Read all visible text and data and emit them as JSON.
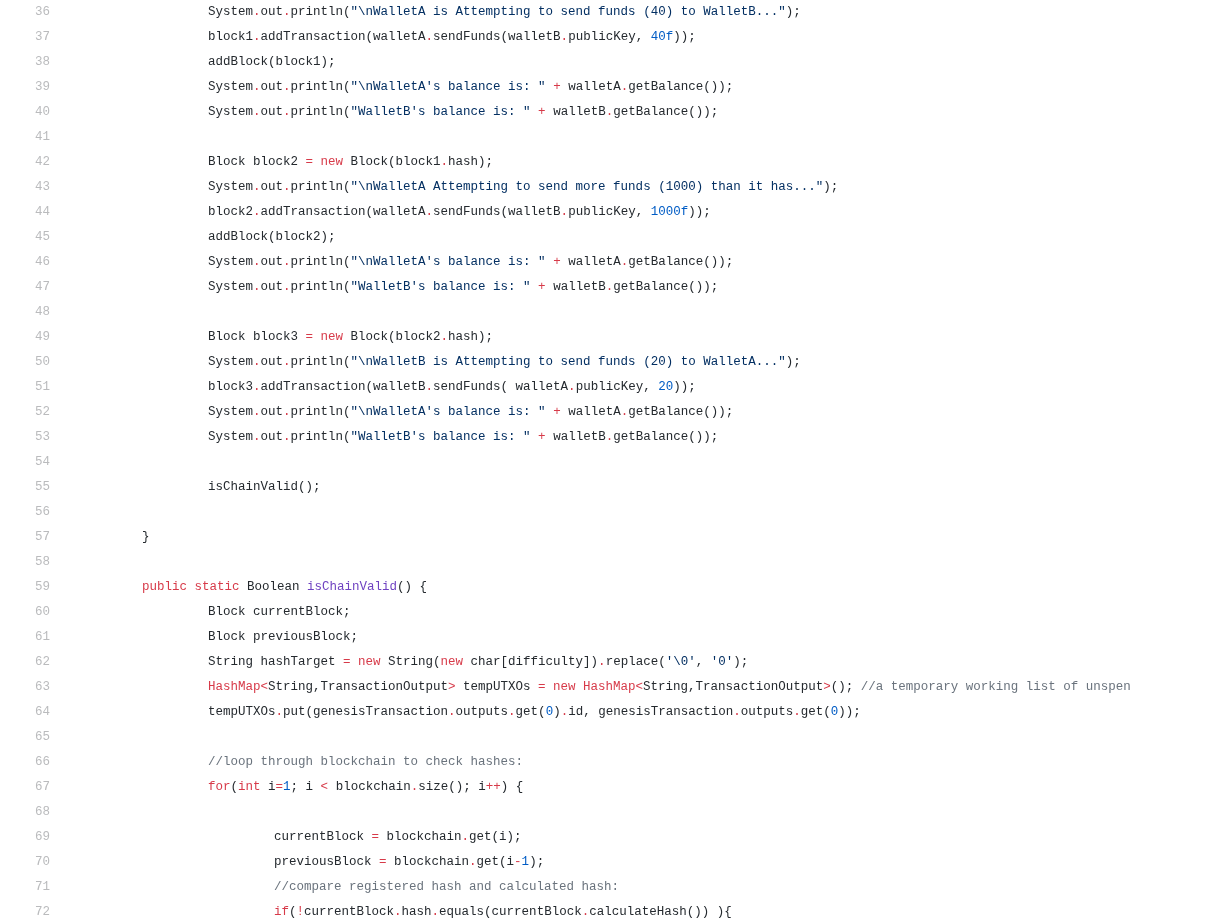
{
  "code_lines": [
    {
      "number": "36",
      "tokens": [
        {
          "kind": "p",
          "text": "\t\tSystem"
        },
        {
          "kind": "o",
          "text": "."
        },
        {
          "kind": "p",
          "text": "out"
        },
        {
          "kind": "o",
          "text": "."
        },
        {
          "kind": "p",
          "text": "println("
        },
        {
          "kind": "s",
          "text": "\"\\nWalletA is Attempting to send funds (40) to WalletB...\""
        },
        {
          "kind": "p",
          "text": ");"
        }
      ]
    },
    {
      "number": "37",
      "tokens": [
        {
          "kind": "p",
          "text": "\t\tblock1"
        },
        {
          "kind": "o",
          "text": "."
        },
        {
          "kind": "p",
          "text": "addTransaction(walletA"
        },
        {
          "kind": "o",
          "text": "."
        },
        {
          "kind": "p",
          "text": "sendFunds(walletB"
        },
        {
          "kind": "o",
          "text": "."
        },
        {
          "kind": "p",
          "text": "publicKey, "
        },
        {
          "kind": "n",
          "text": "40f"
        },
        {
          "kind": "p",
          "text": "));"
        }
      ]
    },
    {
      "number": "38",
      "tokens": [
        {
          "kind": "p",
          "text": "\t\taddBlock(block1);"
        }
      ]
    },
    {
      "number": "39",
      "tokens": [
        {
          "kind": "p",
          "text": "\t\tSystem"
        },
        {
          "kind": "o",
          "text": "."
        },
        {
          "kind": "p",
          "text": "out"
        },
        {
          "kind": "o",
          "text": "."
        },
        {
          "kind": "p",
          "text": "println("
        },
        {
          "kind": "s",
          "text": "\"\\nWalletA's balance is: \""
        },
        {
          "kind": "o",
          "text": " + "
        },
        {
          "kind": "p",
          "text": "walletA"
        },
        {
          "kind": "o",
          "text": "."
        },
        {
          "kind": "p",
          "text": "getBalance());"
        }
      ]
    },
    {
      "number": "40",
      "tokens": [
        {
          "kind": "p",
          "text": "\t\tSystem"
        },
        {
          "kind": "o",
          "text": "."
        },
        {
          "kind": "p",
          "text": "out"
        },
        {
          "kind": "o",
          "text": "."
        },
        {
          "kind": "p",
          "text": "println("
        },
        {
          "kind": "s",
          "text": "\"WalletB's balance is: \""
        },
        {
          "kind": "o",
          "text": " + "
        },
        {
          "kind": "p",
          "text": "walletB"
        },
        {
          "kind": "o",
          "text": "."
        },
        {
          "kind": "p",
          "text": "getBalance());"
        }
      ]
    },
    {
      "number": "41"
    },
    {
      "number": "42",
      "tokens": [
        {
          "kind": "p",
          "text": "\t\tBlock block2 "
        },
        {
          "kind": "o",
          "text": "= new"
        },
        {
          "kind": "p",
          "text": " Block(block1"
        },
        {
          "kind": "o",
          "text": "."
        },
        {
          "kind": "p",
          "text": "hash);"
        }
      ]
    },
    {
      "number": "43",
      "tokens": [
        {
          "kind": "p",
          "text": "\t\tSystem"
        },
        {
          "kind": "o",
          "text": "."
        },
        {
          "kind": "p",
          "text": "out"
        },
        {
          "kind": "o",
          "text": "."
        },
        {
          "kind": "p",
          "text": "println("
        },
        {
          "kind": "s",
          "text": "\"\\nWalletA Attempting to send more funds (1000) than it has...\""
        },
        {
          "kind": "p",
          "text": ");"
        }
      ]
    },
    {
      "number": "44",
      "tokens": [
        {
          "kind": "p",
          "text": "\t\tblock2"
        },
        {
          "kind": "o",
          "text": "."
        },
        {
          "kind": "p",
          "text": "addTransaction(walletA"
        },
        {
          "kind": "o",
          "text": "."
        },
        {
          "kind": "p",
          "text": "sendFunds(walletB"
        },
        {
          "kind": "o",
          "text": "."
        },
        {
          "kind": "p",
          "text": "publicKey, "
        },
        {
          "kind": "n",
          "text": "1000f"
        },
        {
          "kind": "p",
          "text": "));"
        }
      ]
    },
    {
      "number": "45",
      "tokens": [
        {
          "kind": "p",
          "text": "\t\taddBlock(block2);"
        }
      ]
    },
    {
      "number": "46",
      "tokens": [
        {
          "kind": "p",
          "text": "\t\tSystem"
        },
        {
          "kind": "o",
          "text": "."
        },
        {
          "kind": "p",
          "text": "out"
        },
        {
          "kind": "o",
          "text": "."
        },
        {
          "kind": "p",
          "text": "println("
        },
        {
          "kind": "s",
          "text": "\"\\nWalletA's balance is: \""
        },
        {
          "kind": "o",
          "text": " + "
        },
        {
          "kind": "p",
          "text": "walletA"
        },
        {
          "kind": "o",
          "text": "."
        },
        {
          "kind": "p",
          "text": "getBalance());"
        }
      ]
    },
    {
      "number": "47",
      "tokens": [
        {
          "kind": "p",
          "text": "\t\tSystem"
        },
        {
          "kind": "o",
          "text": "."
        },
        {
          "kind": "p",
          "text": "out"
        },
        {
          "kind": "o",
          "text": "."
        },
        {
          "kind": "p",
          "text": "println("
        },
        {
          "kind": "s",
          "text": "\"WalletB's balance is: \""
        },
        {
          "kind": "o",
          "text": " + "
        },
        {
          "kind": "p",
          "text": "walletB"
        },
        {
          "kind": "o",
          "text": "."
        },
        {
          "kind": "p",
          "text": "getBalance());"
        }
      ]
    },
    {
      "number": "48"
    },
    {
      "number": "49",
      "tokens": [
        {
          "kind": "p",
          "text": "\t\tBlock block3 "
        },
        {
          "kind": "o",
          "text": "= new"
        },
        {
          "kind": "p",
          "text": " Block(block2"
        },
        {
          "kind": "o",
          "text": "."
        },
        {
          "kind": "p",
          "text": "hash);"
        }
      ]
    },
    {
      "number": "50",
      "tokens": [
        {
          "kind": "p",
          "text": "\t\tSystem"
        },
        {
          "kind": "o",
          "text": "."
        },
        {
          "kind": "p",
          "text": "out"
        },
        {
          "kind": "o",
          "text": "."
        },
        {
          "kind": "p",
          "text": "println("
        },
        {
          "kind": "s",
          "text": "\"\\nWalletB is Attempting to send funds (20) to WalletA...\""
        },
        {
          "kind": "p",
          "text": ");"
        }
      ]
    },
    {
      "number": "51",
      "tokens": [
        {
          "kind": "p",
          "text": "\t\tblock3"
        },
        {
          "kind": "o",
          "text": "."
        },
        {
          "kind": "p",
          "text": "addTransaction(walletB"
        },
        {
          "kind": "o",
          "text": "."
        },
        {
          "kind": "p",
          "text": "sendFunds( walletA"
        },
        {
          "kind": "o",
          "text": "."
        },
        {
          "kind": "p",
          "text": "publicKey, "
        },
        {
          "kind": "n",
          "text": "20"
        },
        {
          "kind": "p",
          "text": "));"
        }
      ]
    },
    {
      "number": "52",
      "tokens": [
        {
          "kind": "p",
          "text": "\t\tSystem"
        },
        {
          "kind": "o",
          "text": "."
        },
        {
          "kind": "p",
          "text": "out"
        },
        {
          "kind": "o",
          "text": "."
        },
        {
          "kind": "p",
          "text": "println("
        },
        {
          "kind": "s",
          "text": "\"\\nWalletA's balance is: \""
        },
        {
          "kind": "o",
          "text": " + "
        },
        {
          "kind": "p",
          "text": "walletA"
        },
        {
          "kind": "o",
          "text": "."
        },
        {
          "kind": "p",
          "text": "getBalance());"
        }
      ]
    },
    {
      "number": "53",
      "tokens": [
        {
          "kind": "p",
          "text": "\t\tSystem"
        },
        {
          "kind": "o",
          "text": "."
        },
        {
          "kind": "p",
          "text": "out"
        },
        {
          "kind": "o",
          "text": "."
        },
        {
          "kind": "p",
          "text": "println("
        },
        {
          "kind": "s",
          "text": "\"WalletB's balance is: \""
        },
        {
          "kind": "o",
          "text": " + "
        },
        {
          "kind": "p",
          "text": "walletB"
        },
        {
          "kind": "o",
          "text": "."
        },
        {
          "kind": "p",
          "text": "getBalance());"
        }
      ]
    },
    {
      "number": "54"
    },
    {
      "number": "55",
      "tokens": [
        {
          "kind": "p",
          "text": "\t\tisChainValid();"
        }
      ]
    },
    {
      "number": "56"
    },
    {
      "number": "57",
      "tokens": [
        {
          "kind": "p",
          "text": "\t}"
        }
      ]
    },
    {
      "number": "58"
    },
    {
      "number": "59",
      "tokens": [
        {
          "kind": "o",
          "text": "\tpublic static"
        },
        {
          "kind": "p",
          "text": " Boolean "
        },
        {
          "kind": "f",
          "text": "isChainValid"
        },
        {
          "kind": "p",
          "text": "() {"
        }
      ]
    },
    {
      "number": "60",
      "tokens": [
        {
          "kind": "p",
          "text": "\t\tBlock currentBlock;"
        }
      ]
    },
    {
      "number": "61",
      "tokens": [
        {
          "kind": "p",
          "text": "\t\tBlock previousBlock;"
        }
      ]
    },
    {
      "number": "62",
      "tokens": [
        {
          "kind": "p",
          "text": "\t\tString hashTarget "
        },
        {
          "kind": "o",
          "text": "= new"
        },
        {
          "kind": "p",
          "text": " String("
        },
        {
          "kind": "o",
          "text": "new"
        },
        {
          "kind": "p",
          "text": " char[difficulty])"
        },
        {
          "kind": "o",
          "text": "."
        },
        {
          "kind": "p",
          "text": "replace("
        },
        {
          "kind": "s",
          "text": "'\\0'"
        },
        {
          "kind": "p",
          "text": ", "
        },
        {
          "kind": "s",
          "text": "'0'"
        },
        {
          "kind": "p",
          "text": ");"
        }
      ]
    },
    {
      "number": "63",
      "tokens": [
        {
          "kind": "o",
          "text": "\t\tHashMap<"
        },
        {
          "kind": "p",
          "text": "String,TransactionOutput"
        },
        {
          "kind": "o",
          "text": ">"
        },
        {
          "kind": "p",
          "text": " tempUTXOs "
        },
        {
          "kind": "o",
          "text": "= new HashMap<"
        },
        {
          "kind": "p",
          "text": "String,TransactionOutput"
        },
        {
          "kind": "o",
          "text": ">"
        },
        {
          "kind": "p",
          "text": "(); "
        },
        {
          "kind": "c",
          "text": "//a temporary working list of unspen"
        }
      ]
    },
    {
      "number": "64",
      "tokens": [
        {
          "kind": "p",
          "text": "\t\ttempUTXOs"
        },
        {
          "kind": "o",
          "text": "."
        },
        {
          "kind": "p",
          "text": "put(genesisTransaction"
        },
        {
          "kind": "o",
          "text": "."
        },
        {
          "kind": "p",
          "text": "outputs"
        },
        {
          "kind": "o",
          "text": "."
        },
        {
          "kind": "p",
          "text": "get("
        },
        {
          "kind": "n",
          "text": "0"
        },
        {
          "kind": "p",
          "text": ")"
        },
        {
          "kind": "o",
          "text": "."
        },
        {
          "kind": "p",
          "text": "id, genesisTransaction"
        },
        {
          "kind": "o",
          "text": "."
        },
        {
          "kind": "p",
          "text": "outputs"
        },
        {
          "kind": "o",
          "text": "."
        },
        {
          "kind": "p",
          "text": "get("
        },
        {
          "kind": "n",
          "text": "0"
        },
        {
          "kind": "p",
          "text": "));"
        }
      ]
    },
    {
      "number": "65"
    },
    {
      "number": "66",
      "tokens": [
        {
          "kind": "c",
          "text": "\t\t//loop through blockchain to check hashes:"
        }
      ]
    },
    {
      "number": "67",
      "tokens": [
        {
          "kind": "o",
          "text": "\t\tfor"
        },
        {
          "kind": "p",
          "text": "("
        },
        {
          "kind": "o",
          "text": "int"
        },
        {
          "kind": "p",
          "text": " i"
        },
        {
          "kind": "o",
          "text": "="
        },
        {
          "kind": "n",
          "text": "1"
        },
        {
          "kind": "p",
          "text": "; i "
        },
        {
          "kind": "o",
          "text": "<"
        },
        {
          "kind": "p",
          "text": " blockchain"
        },
        {
          "kind": "o",
          "text": "."
        },
        {
          "kind": "p",
          "text": "size(); i"
        },
        {
          "kind": "o",
          "text": "++"
        },
        {
          "kind": "p",
          "text": ") {"
        }
      ]
    },
    {
      "number": "68"
    },
    {
      "number": "69",
      "tokens": [
        {
          "kind": "p",
          "text": "\t\t\tcurrentBlock "
        },
        {
          "kind": "o",
          "text": "="
        },
        {
          "kind": "p",
          "text": " blockchain"
        },
        {
          "kind": "o",
          "text": "."
        },
        {
          "kind": "p",
          "text": "get(i);"
        }
      ]
    },
    {
      "number": "70",
      "tokens": [
        {
          "kind": "p",
          "text": "\t\t\tpreviousBlock "
        },
        {
          "kind": "o",
          "text": "="
        },
        {
          "kind": "p",
          "text": " blockchain"
        },
        {
          "kind": "o",
          "text": "."
        },
        {
          "kind": "p",
          "text": "get(i"
        },
        {
          "kind": "o",
          "text": "-"
        },
        {
          "kind": "n",
          "text": "1"
        },
        {
          "kind": "p",
          "text": ");"
        }
      ]
    },
    {
      "number": "71",
      "tokens": [
        {
          "kind": "c",
          "text": "\t\t\t//compare registered hash and calculated hash:"
        }
      ]
    },
    {
      "number": "72",
      "tokens": [
        {
          "kind": "o",
          "text": "\t\t\tif"
        },
        {
          "kind": "p",
          "text": "("
        },
        {
          "kind": "o",
          "text": "!"
        },
        {
          "kind": "p",
          "text": "currentBlock"
        },
        {
          "kind": "o",
          "text": "."
        },
        {
          "kind": "p",
          "text": "hash"
        },
        {
          "kind": "o",
          "text": "."
        },
        {
          "kind": "p",
          "text": "equals(currentBlock"
        },
        {
          "kind": "o",
          "text": "."
        },
        {
          "kind": "p",
          "text": "calculateHash()) ){"
        }
      ]
    }
  ]
}
